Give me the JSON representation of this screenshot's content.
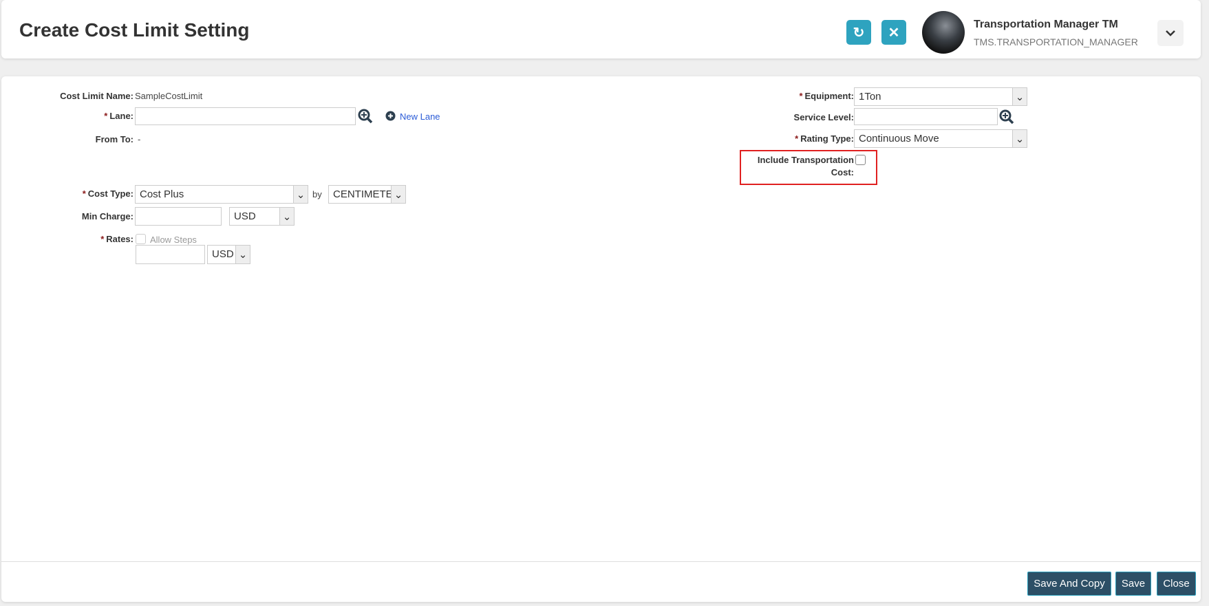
{
  "header": {
    "title": "Create Cost Limit Setting",
    "user_name": "Transportation Manager TM",
    "user_role": "TMS.TRANSPORTATION_MANAGER"
  },
  "form": {
    "cost_limit_name_label": "Cost Limit Name:",
    "cost_limit_name_value": "SampleCostLimit",
    "required_mark": "*",
    "lane_label": "Lane:",
    "lane_value": "",
    "new_lane_link": "New Lane",
    "from_to_label": "From To:",
    "from_to_value": "-",
    "cost_type_label": "Cost Type:",
    "cost_type_value": "Cost Plus",
    "by_label": "by",
    "unit_value": "CENTIMETE",
    "min_charge_label": "Min Charge:",
    "min_charge_value": "",
    "min_charge_currency": "USD",
    "rates_label": "Rates:",
    "allow_steps_label": "Allow Steps",
    "rates_value": "",
    "rates_currency": "USD",
    "equipment_label": "Equipment:",
    "equipment_value": "1Ton",
    "service_level_label": "Service Level:",
    "service_level_value": "",
    "rating_type_label": "Rating Type:",
    "rating_type_value": "Continuous Move",
    "include_transport_label_1": "Include Transportation",
    "include_transport_label_2": "Cost:",
    "include_transport_checked": false
  },
  "footer": {
    "save_and_copy": "Save And Copy",
    "save": "Save",
    "close": "Close"
  },
  "colors": {
    "accent": "#2ea3bf",
    "button": "#2d4f66",
    "highlight": "#e02020"
  }
}
